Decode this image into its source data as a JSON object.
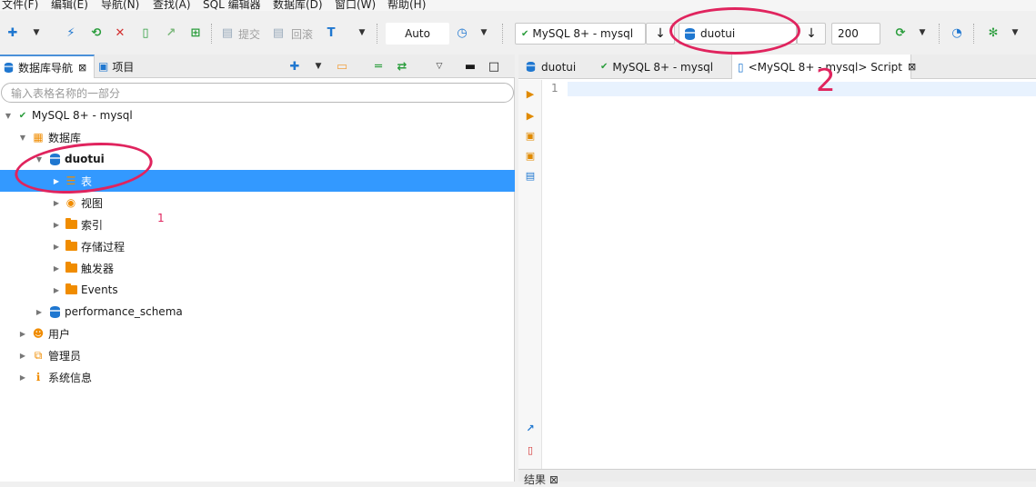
{
  "menu": [
    "文件(F)",
    "编辑(E)",
    "导航(N)",
    "查找(A)",
    "SQL 编辑器",
    "数据库(D)",
    "窗口(W)",
    "帮助(H)"
  ],
  "toolbar": {
    "commit_label": "提交",
    "rollback_label": "回滚",
    "transaction_mode": "Auto",
    "connection": "MySQL 8+ - mysql",
    "database": "duotui",
    "result_limit": "200"
  },
  "left_panel": {
    "tabs": [
      {
        "label": "数据库导航",
        "close": "⊠"
      },
      {
        "label": "项目"
      }
    ],
    "filter_placeholder": "输入表格名称的一部分",
    "tree": {
      "connection": "MySQL 8+ - mysql",
      "databases_folder": "数据库",
      "db_duotui": "duotui",
      "tables": "表",
      "views": "视图",
      "indexes": "索引",
      "procedures": "存储过程",
      "triggers": "触发器",
      "events": "Events",
      "db_performance": "performance_schema",
      "users": "用户",
      "admins": "管理员",
      "system_info": "系统信息"
    }
  },
  "right_panel": {
    "tabs": [
      {
        "label": "duotui"
      },
      {
        "label": "MySQL 8+ - mysql"
      },
      {
        "label": "<MySQL 8+ - mysql> Script",
        "close": "⊠"
      }
    ],
    "line_number": "1",
    "bottom_tab": "结果 ⊠"
  },
  "annotations": {
    "one": "1",
    "two": "2"
  },
  "colors": {
    "selection": "#3399ff",
    "annotation": "#e0245e",
    "folder": "#f08c00",
    "database": "#1f77d0"
  }
}
